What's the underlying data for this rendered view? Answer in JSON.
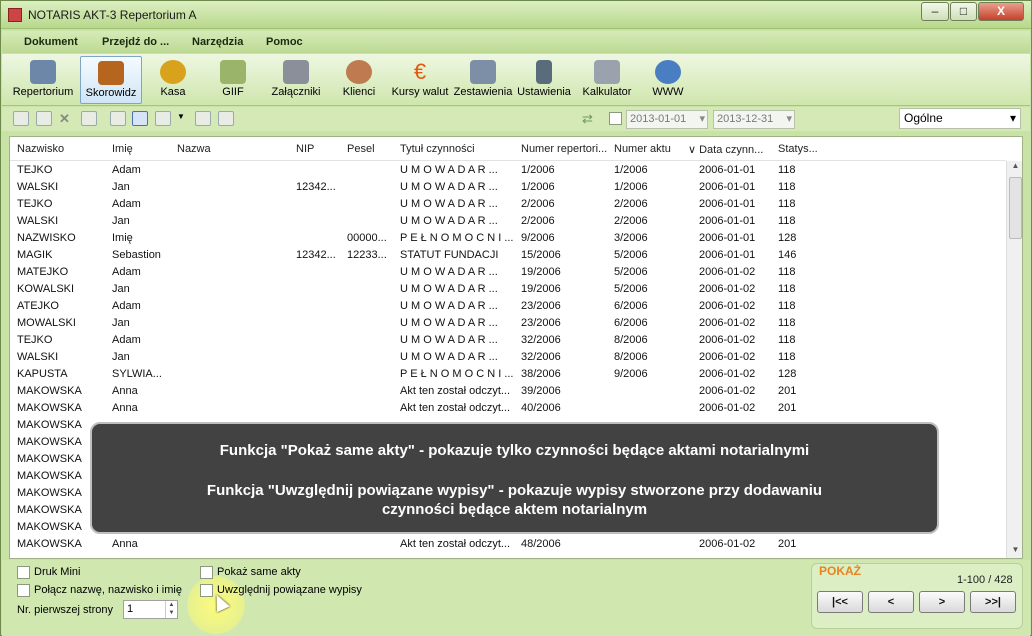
{
  "window": {
    "title": "NOTARIS AKT-3 Repertorium A",
    "minimize": "–",
    "maximize": "□",
    "close": "X"
  },
  "menu": [
    "Dokument",
    "Przejdź do ...",
    "Narzędzia",
    "Pomoc"
  ],
  "toolbar": [
    {
      "label": "Repertorium",
      "icon": "book-icon",
      "color": "#6d87a8"
    },
    {
      "label": "Skorowidz",
      "icon": "index-icon",
      "color": "#b5651d"
    },
    {
      "label": "Kasa",
      "icon": "coins-icon",
      "color": "#d8a21c"
    },
    {
      "label": "GIIF",
      "icon": "folder-icon",
      "color": "#9ab46a"
    },
    {
      "label": "Załączniki",
      "icon": "attachment-icon",
      "color": "#8a8f99"
    },
    {
      "label": "Klienci",
      "icon": "clients-icon",
      "color": "#c07a50"
    },
    {
      "label": "Kursy walut",
      "icon": "euro-icon",
      "color": "#e05a10"
    },
    {
      "label": "Zestawienia",
      "icon": "report-icon",
      "color": "#7d8fa6"
    },
    {
      "label": "Ustawienia",
      "icon": "tools-icon",
      "color": "#5a6b7c"
    },
    {
      "label": "Kalkulator",
      "icon": "calculator-icon",
      "color": "#9aa3ad"
    },
    {
      "label": "WWW",
      "icon": "globe-icon",
      "color": "#4a7ec2"
    }
  ],
  "filters": {
    "date_from": "2013-01-01",
    "date_to": "2013-12-31",
    "category": "Ogólne"
  },
  "columns": [
    "Nazwisko",
    "Imię",
    "Nazwa",
    "NIP",
    "Pesel",
    "Tytuł czynności",
    "Numer repertori...",
    "Numer aktu",
    "∨ Data czynn...",
    "Statys..."
  ],
  "rows": [
    [
      "TEJKO",
      "Adam",
      "",
      "",
      "",
      "U M O W A  D A R ...",
      "1/2006",
      "1/2006",
      "2006-01-01",
      "118"
    ],
    [
      "WALSKI",
      "Jan",
      "",
      "12342...",
      "",
      "U M O W A  D A R ...",
      "1/2006",
      "1/2006",
      "2006-01-01",
      "118"
    ],
    [
      "TEJKO",
      "Adam",
      "",
      "",
      "",
      "U M O W A  D A R ...",
      "2/2006",
      "2/2006",
      "2006-01-01",
      "118"
    ],
    [
      "WALSKI",
      "Jan",
      "",
      "",
      "",
      "U M O W A  D A R ...",
      "2/2006",
      "2/2006",
      "2006-01-01",
      "118"
    ],
    [
      "NAZWISKO",
      "Imię",
      "",
      "",
      "00000...",
      "P E Ł N O M O C N I ...",
      "9/2006",
      "3/2006",
      "2006-01-01",
      "128"
    ],
    [
      "MAGIK",
      "Sebastion",
      "",
      "12342...",
      "12233...",
      "STATUT   FUNDACJI",
      "15/2006",
      "5/2006",
      "2006-01-01",
      "146"
    ],
    [
      "MATEJKO",
      "Adam",
      "",
      "",
      "",
      "U M O W A  D A R ...",
      "19/2006",
      "5/2006",
      "2006-01-02",
      "118"
    ],
    [
      "KOWALSKI",
      "Jan",
      "",
      "",
      "",
      "U M O W A  D A R ...",
      "19/2006",
      "5/2006",
      "2006-01-02",
      "118"
    ],
    [
      "ATEJKO",
      "Adam",
      "",
      "",
      "",
      "U M O W A  D A R ...",
      "23/2006",
      "6/2006",
      "2006-01-02",
      "118"
    ],
    [
      "MOWALSKI",
      "Jan",
      "",
      "",
      "",
      "U M O W A  D A R ...",
      "23/2006",
      "6/2006",
      "2006-01-02",
      "118"
    ],
    [
      "TEJKO",
      "Adam",
      "",
      "",
      "",
      "U M O W A  D A R ...",
      "32/2006",
      "8/2006",
      "2006-01-02",
      "118"
    ],
    [
      "WALSKI",
      "Jan",
      "",
      "",
      "",
      "U M O W A  D A R ...",
      "32/2006",
      "8/2006",
      "2006-01-02",
      "118"
    ],
    [
      "KAPUSTA",
      "SYLWIA...",
      "",
      "",
      "",
      "P E Ł N O M O C N I ...",
      "38/2006",
      "9/2006",
      "2006-01-02",
      "128"
    ],
    [
      "MAKOWSKA",
      "Anna",
      "",
      "",
      "",
      "Akt ten został odczyt...",
      "39/2006",
      "",
      "2006-01-02",
      "201"
    ],
    [
      "MAKOWSKA",
      "Anna",
      "",
      "",
      "",
      "Akt ten został odczyt...",
      "40/2006",
      "",
      "2006-01-02",
      "201"
    ],
    [
      "MAKOWSKA",
      "",
      "",
      "",
      "",
      "",
      "",
      "",
      "",
      ""
    ],
    [
      "MAKOWSKA",
      "",
      "",
      "",
      "",
      "",
      "",
      "",
      "",
      ""
    ],
    [
      "MAKOWSKA",
      "",
      "",
      "",
      "",
      "",
      "",
      "",
      "",
      ""
    ],
    [
      "MAKOWSKA",
      "",
      "",
      "",
      "",
      "",
      "",
      "",
      "",
      ""
    ],
    [
      "MAKOWSKA",
      "",
      "",
      "",
      "",
      "",
      "",
      "",
      "",
      ""
    ],
    [
      "MAKOWSKA",
      "",
      "",
      "",
      "",
      "",
      "",
      "",
      "",
      ""
    ],
    [
      "MAKOWSKA",
      "",
      "",
      "",
      "",
      "",
      "",
      "",
      "",
      ""
    ],
    [
      "MAKOWSKA",
      "Anna",
      "",
      "",
      "",
      "Akt ten został odczyt...",
      "48/2006",
      "",
      "2006-01-02",
      "201"
    ]
  ],
  "overlay": {
    "line1": "Funkcja \"Pokaż same akty\" - pokazuje tylko czynności będące aktami notarialnymi",
    "line2": "Funkcja \"Uwzględnij powiązane wypisy\" - pokazuje wypisy stworzone przy dodawaniu",
    "line3": "czynności będące aktem notarialnym"
  },
  "options": {
    "druk_mini": "Druk Mini",
    "polacz": "Połącz nazwę, nazwisko i imię",
    "pokaz_same_akty": "Pokaż same akty",
    "uwzglednij": "Uwzględnij powiązane wypisy",
    "first_page_label": "Nr. pierwszej strony",
    "first_page_value": "1"
  },
  "pager": {
    "title": "POKAŻ",
    "info": "1-100 / 428",
    "first": "|<<",
    "prev": "<",
    "next": ">",
    "last": ">>|"
  }
}
